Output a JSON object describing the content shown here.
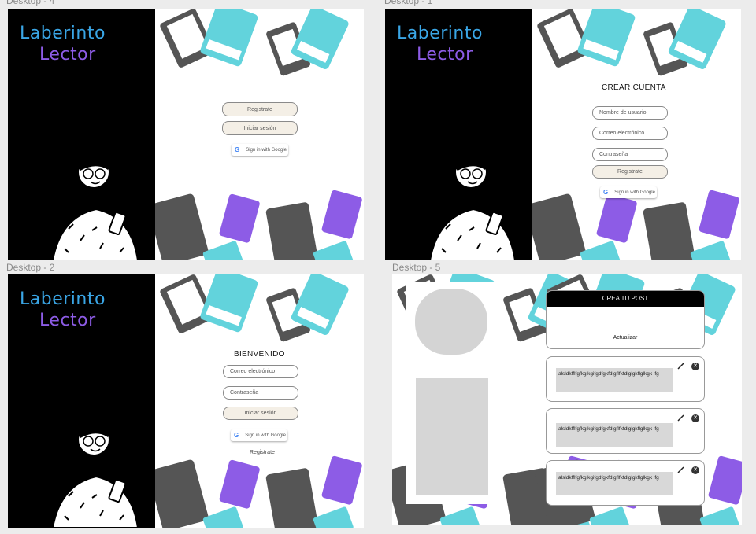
{
  "frames": {
    "desktop4": {
      "label": "Desktop - 4",
      "brand_line1": "Laberinto",
      "brand_line2": "Lector",
      "register_label": "Registrate",
      "login_label": "Iniciar sesión",
      "google_label": "Sign in with Google"
    },
    "desktop1": {
      "label": "Desktop - 1",
      "brand_line1": "Laberinto",
      "brand_line2": "Lector",
      "title": "CREAR CUENTA",
      "username_placeholder": "Nombre de usuario",
      "email_placeholder": "Correo electrónico",
      "password_placeholder": "Contraseña",
      "register_label": "Registrate",
      "google_label": "Sign in with Google"
    },
    "desktop2": {
      "label": "Desktop - 2",
      "brand_line1": "Laberinto",
      "brand_line2": "Lector",
      "title": "BIENVENIDO",
      "email_placeholder": "Correo electrónico",
      "password_placeholder": "Contraseña",
      "login_label": "Iniciar sesión",
      "google_label": "Sign in with Google",
      "register_link": "Registrate"
    },
    "desktop5": {
      "label": "Desktop - 5",
      "create_title": "CREA TU POST",
      "update_label": "Actualizar",
      "posts": [
        {
          "text": "alsldkfflfgfkglkgifgdfgkfdlgflfkfdlglgkflglkgk lfg"
        },
        {
          "text": "alsldkfflfgfkglkgifgdfgkfdlgflfkfdlglgkflglkgk lfg"
        },
        {
          "text": "alsldkfflfgfkglkgifgdfgkfdlgflfkfdlglgkflglkgk lfg"
        }
      ]
    }
  },
  "icons": {
    "google": "google-g-icon",
    "pencil": "pencil-icon",
    "close": "close-icon"
  },
  "colors": {
    "brand_blue": "#3aa6e6",
    "brand_purple": "#8d5ce6",
    "book_teal": "#62d3dc",
    "book_grey": "#555555"
  }
}
